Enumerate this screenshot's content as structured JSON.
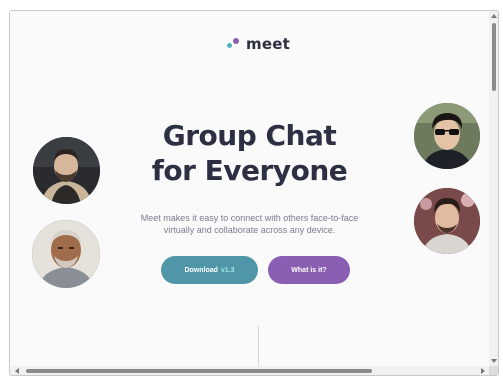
{
  "brand": {
    "name": "meet",
    "dot_colors": {
      "cyan": "#4fb2c4",
      "purple": "#8a5fb3"
    }
  },
  "hero": {
    "headline_line1": "Group Chat",
    "headline_line2": "for Everyone",
    "subtext_line1": "Meet makes it easy to connect with others face-to-face",
    "subtext_line2": "virtually and collaborate across any device."
  },
  "buttons": {
    "download_label": "Download",
    "download_version": "v1.3",
    "what_label": "What is it?"
  },
  "colors": {
    "headline": "#2d2f42",
    "download_button": "#4f97a8",
    "what_button": "#8a5fb3",
    "background": "#fafafb"
  },
  "avatars": [
    {
      "name": "avatar-man-beard"
    },
    {
      "name": "avatar-older-man"
    },
    {
      "name": "avatar-man-sunglasses"
    },
    {
      "name": "avatar-young-man"
    }
  ]
}
